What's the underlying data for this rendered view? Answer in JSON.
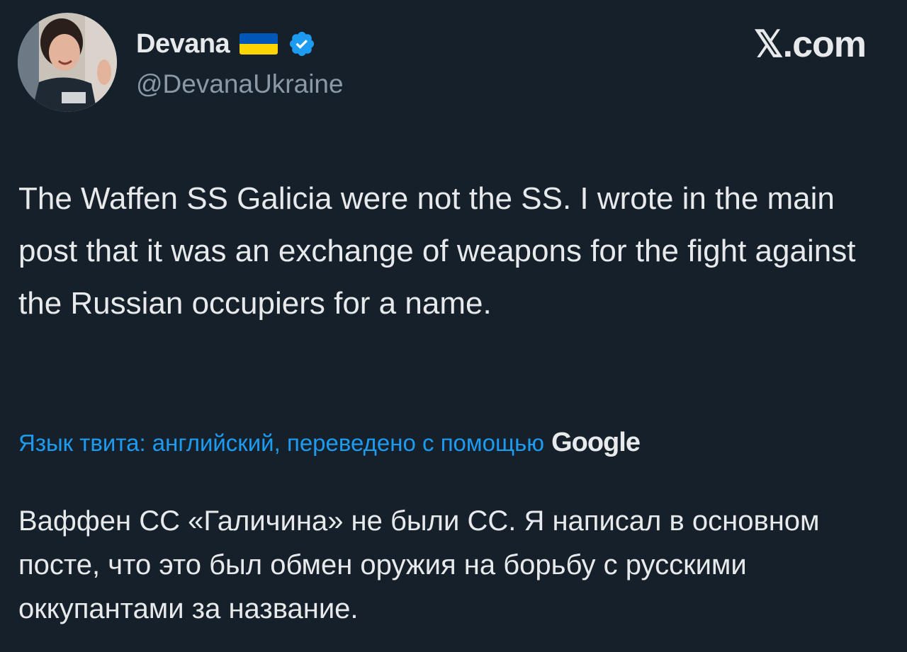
{
  "author": {
    "display_name": "Devana",
    "handle": "@DevanaUkraine",
    "flag_icon": "ukraine-flag-icon",
    "verified_icon": "verified-badge-icon"
  },
  "brand": {
    "watermark": "𝕏.com"
  },
  "tweet": {
    "text": "The Waffen SS Galicia were not the SS. I wrote in the main post that it was an exchange of weapons for the fight against the Russian occupiers for a name."
  },
  "translation": {
    "label": "Язык твита: английский, переведено с помощью",
    "provider": "Google",
    "text": "Ваффен СС «Галичина» не были СС. Я написал в основном посте, что это был обмен оружия на борьбу с русскими оккупантами за название."
  },
  "colors": {
    "background": "#15202b",
    "text": "#e7e9ea",
    "secondary": "#8b98a5",
    "accent": "#1d9bf0",
    "flag_blue": "#0057b7",
    "flag_yellow": "#ffd500"
  }
}
